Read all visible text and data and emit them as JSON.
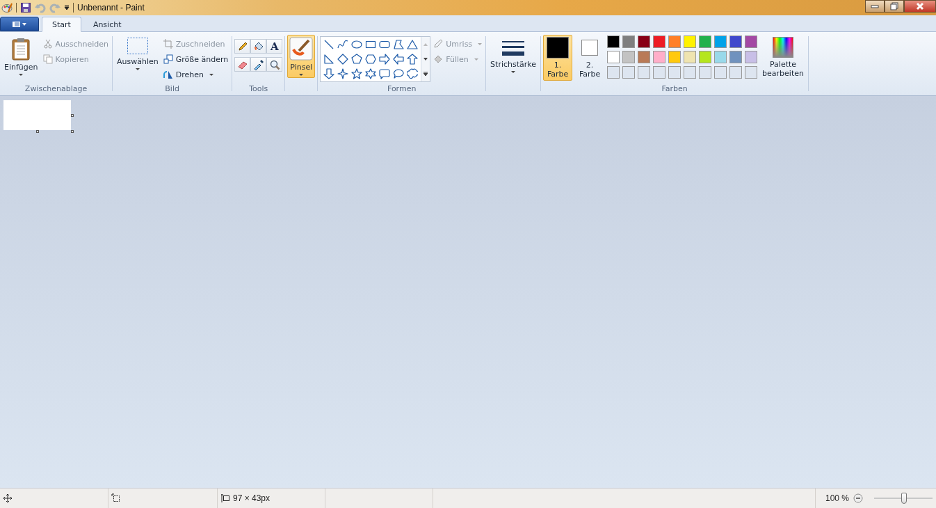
{
  "window": {
    "title": "Unbenannt - Paint"
  },
  "tabs": [
    {
      "label": "Start",
      "selected": true
    },
    {
      "label": "Ansicht",
      "selected": false
    }
  ],
  "clipboard": {
    "paste": "Einfügen",
    "cut": {
      "label": "Ausschneiden",
      "disabled": true
    },
    "copy": {
      "label": "Kopieren",
      "disabled": true
    },
    "group": "Zwischenablage"
  },
  "image": {
    "select": "Auswählen",
    "crop": {
      "label": "Zuschneiden",
      "disabled": true
    },
    "resize": {
      "label": "Größe ändern",
      "disabled": false
    },
    "rotate": {
      "label": "Drehen",
      "disabled": false
    },
    "group": "Bild"
  },
  "tools": {
    "text_tool": "A",
    "group": "Tools"
  },
  "brush": {
    "label": "Pinsel",
    "selected": true
  },
  "shapes": {
    "outline": {
      "label": "Umriss",
      "disabled": true
    },
    "fill": {
      "label": "Füllen",
      "disabled": true
    },
    "group": "Formen"
  },
  "stroke": {
    "label": "Strichstärke"
  },
  "colors": {
    "color_1": {
      "label": "1. Farbe",
      "selected": true,
      "color": "#000000"
    },
    "color_2": {
      "label": "2. Farbe",
      "selected": false,
      "color": "#ffffff"
    },
    "palette": [
      {
        "color": "#000000"
      },
      {
        "color": "#7f7f7f"
      },
      {
        "color": "#880015"
      },
      {
        "color": "#ed1c24"
      },
      {
        "color": "#ff7f27"
      },
      {
        "color": "#fff200"
      },
      {
        "color": "#22b14c"
      },
      {
        "color": "#00a2e8"
      },
      {
        "color": "#3f48cc"
      },
      {
        "color": "#a349a4"
      },
      {
        "color": "#ffffff"
      },
      {
        "color": "#c3c3c3"
      },
      {
        "color": "#b97a57"
      },
      {
        "color": "#ffaec9"
      },
      {
        "color": "#ffc90e"
      },
      {
        "color": "#efe4b0"
      },
      {
        "color": "#b5e61d"
      },
      {
        "color": "#99d9ea"
      },
      {
        "color": "#7092be"
      },
      {
        "color": "#c8bfe7"
      }
    ],
    "edit_palette": "Palette bearbeiten",
    "group": "Farben"
  },
  "status_bar": {
    "size": "97 × 43px",
    "zoom": "100 %",
    "zoom_slider": {
      "level": 0.51
    }
  }
}
